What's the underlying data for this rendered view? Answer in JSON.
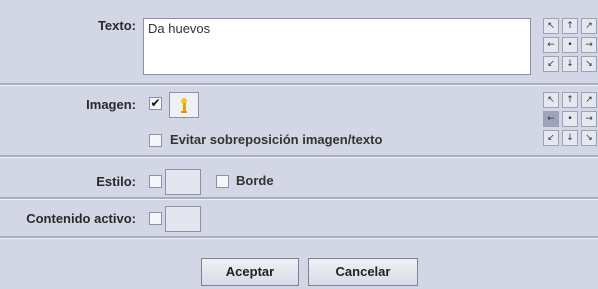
{
  "texto": {
    "label": "Texto:",
    "value": "Da huevos",
    "alignment_pad": [
      [
        "↖",
        "↑",
        "↗"
      ],
      [
        "←",
        "•",
        "→"
      ],
      [
        "↙",
        "↓",
        "↘"
      ]
    ]
  },
  "imagen": {
    "label": "Imagen:",
    "checked": true,
    "check_mark": "✔",
    "image_icon": "chick-icon",
    "avoid_overlap_label": "Evitar sobreposición imagen/texto",
    "avoid_overlap_checked": false,
    "alignment_pad": [
      [
        "↖",
        "↑",
        "↗"
      ],
      [
        "←",
        "•",
        "→"
      ],
      [
        "↙",
        "↓",
        "↘"
      ]
    ]
  },
  "estilo": {
    "label": "Estilo:",
    "border_label": "Borde",
    "border_checked": false
  },
  "contenido_activo": {
    "label": "Contenido activo:"
  },
  "buttons": {
    "accept": "Aceptar",
    "cancel": "Cancelar"
  }
}
